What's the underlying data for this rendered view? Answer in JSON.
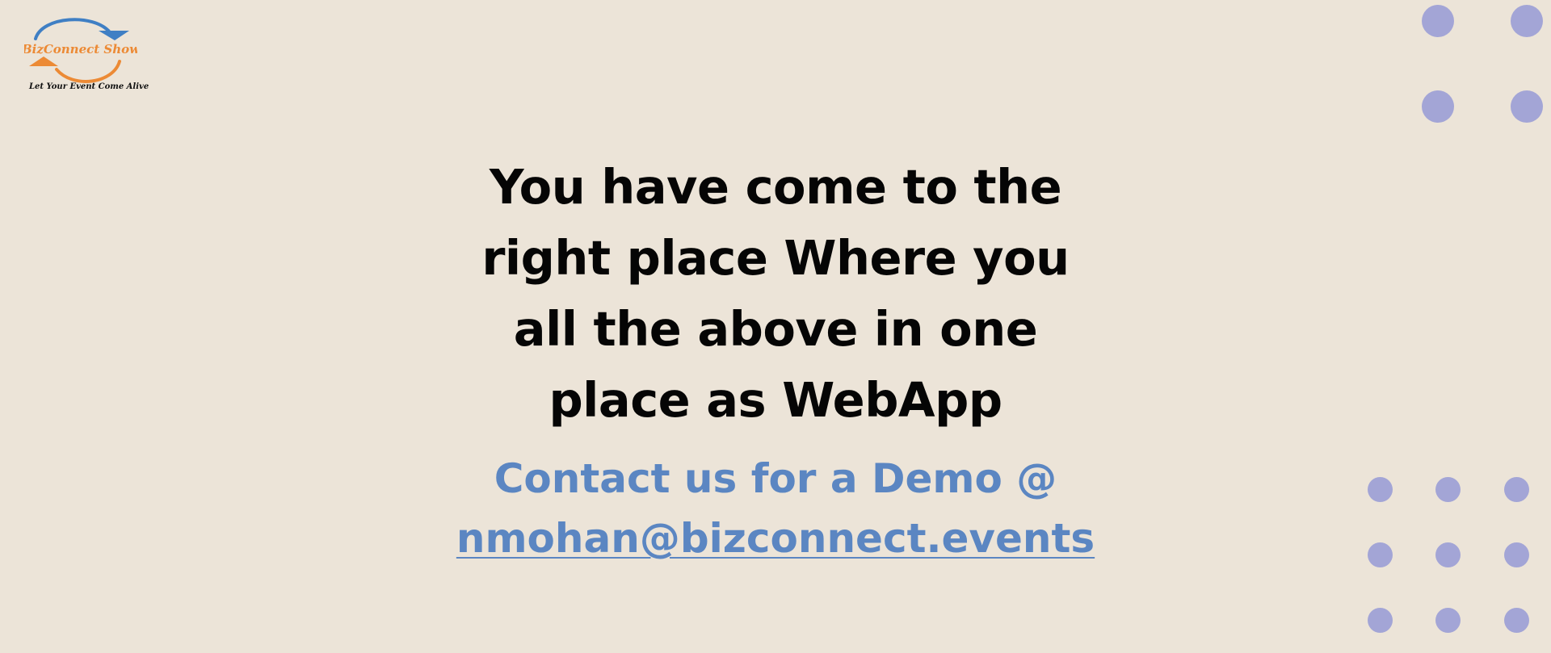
{
  "colors": {
    "background": "#ece4d8",
    "headline": "#050505",
    "accent_blue": "#5b86c2",
    "dot": "#a3a5d6",
    "logo_orange": "#ec8a35",
    "logo_blue": "#3f7fc4"
  },
  "logo": {
    "brand_name": "BizConnect Show",
    "tagline": "Let Your Event Come Alive",
    "icon": "circular-arrows-logo-icon"
  },
  "headline": {
    "lines": [
      "You have come to the",
      "right place Where you",
      "all the above in one",
      "place as WebApp"
    ]
  },
  "contact": {
    "cta": "Contact us for a Demo @",
    "email": "nmohan@bizconnect.events"
  },
  "decorations": {
    "top_right_dots": "dot-grid-decoration",
    "bottom_right_dots": "dot-grid-decoration"
  }
}
